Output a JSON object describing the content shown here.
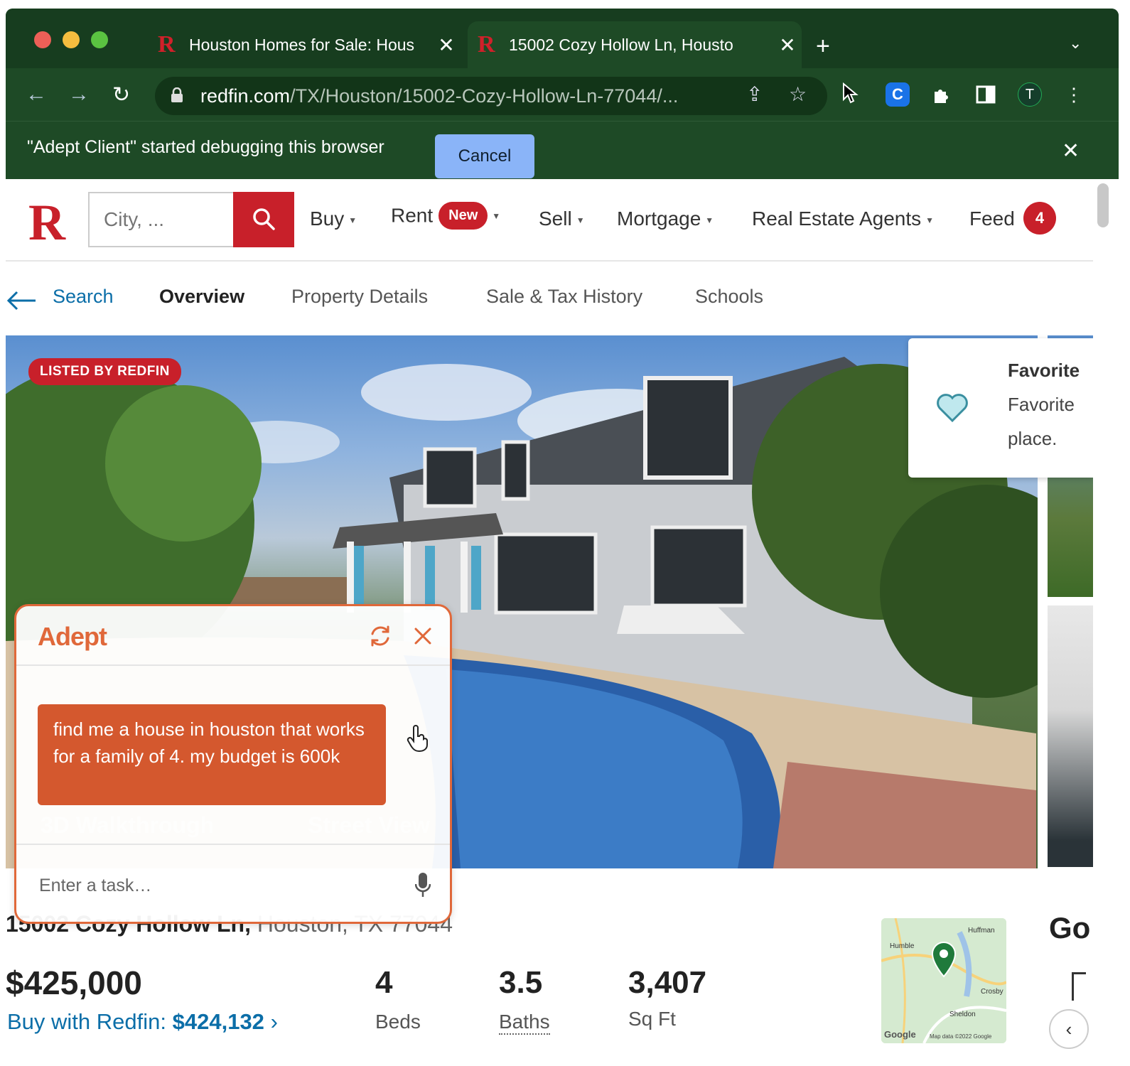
{
  "browser": {
    "tabs": [
      {
        "title": "Houston Homes for Sale: Hous",
        "active": false
      },
      {
        "title": "15002 Cozy Hollow Ln, Housto",
        "active": true
      }
    ],
    "url_host": "redfin.com",
    "url_path": "/TX/Houston/15002-Cozy-Hollow-Ln-77044/...",
    "profile_initial": "T",
    "extension_letter": "C",
    "infobar_text": "\"Adept Client\" started debugging this browser",
    "infobar_button": "Cancel"
  },
  "site": {
    "logo": "R",
    "search_placeholder": "City, ...",
    "nav": {
      "buy": "Buy",
      "rent": "Rent",
      "rent_badge": "New",
      "sell": "Sell",
      "mortgage": "Mortgage",
      "agents": "Real Estate Agents",
      "feed": "Feed",
      "feed_count": "4"
    },
    "subnav": {
      "back": "Search",
      "overview": "Overview",
      "details": "Property Details",
      "history": "Sale & Tax History",
      "schools": "Schools"
    }
  },
  "listing": {
    "badge": "LISTED BY REDFIN",
    "favorite": {
      "title": "Favorite",
      "line1": "Favorite",
      "line2": "place."
    },
    "address_street": "15002 Cozy Hollow Ln,",
    "address_city": "Houston, TX 77044",
    "price": "$425,000",
    "buy_with_label": "Buy with Redfin:",
    "buy_with_amount": "$424,132",
    "beds_value": "4",
    "beds_label": "Beds",
    "baths_value": "3.5",
    "baths_label": "Baths",
    "sqft_value": "3,407",
    "sqft_label": "Sq Ft",
    "go_text": "Go",
    "map_labels": [
      "Huffman",
      "Humble",
      "Crosby",
      "Sheldon",
      "Map data ©2022 Google",
      "Google"
    ]
  },
  "adept": {
    "title": "Adept",
    "message": "find me a house in houston that works for a family of 4. my budget is 600k",
    "ghost_walkthrough": "3D Walkthrough",
    "ghost_streetview": "Street View",
    "input_placeholder": "Enter a task…"
  },
  "colors": {
    "redfin_red": "#c8202a",
    "adept_orange": "#e0683a",
    "browser_green": "#1e4a26",
    "link_blue": "#0b6ea8"
  }
}
